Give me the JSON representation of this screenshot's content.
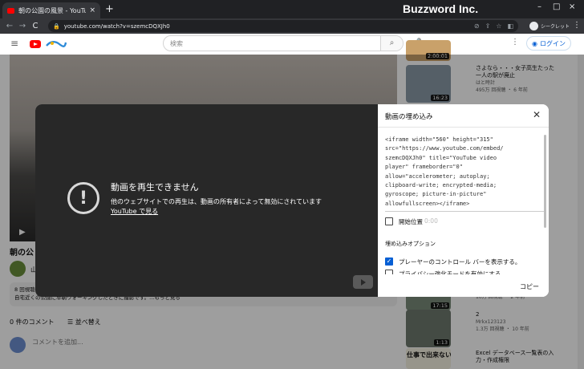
{
  "browser": {
    "tab_title": "朝の公園の風景 - YouTube",
    "close": "×",
    "newtab": "+",
    "back": "←",
    "forward": "→",
    "reload": "C",
    "url": "youtube.com/watch?v=szemcDQXJh0",
    "incognito": "シークレット",
    "brand": "Buzzword Inc.",
    "minimize": "–",
    "maximize": "□",
    "close_win": "×",
    "kebab": "⋮",
    "accent": "#202124"
  },
  "youtube": {
    "search_placeholder": "検索",
    "login": "ログイン",
    "more": "⋮",
    "menu": "≡",
    "mic": "🎤",
    "search_icon": "⌕"
  },
  "video": {
    "title": "朝の公",
    "channel_initial": "山",
    "desc_line1": "8 回視聴",
    "desc_line2": "自宅近くの公園に早朝ウォーキングしたときに撮影です。...もっと見る",
    "play": "▶"
  },
  "comments": {
    "count": "0 件のコメント",
    "sort": "並べ替え",
    "placeholder": "コメントを追加..."
  },
  "related": [
    {
      "duration": "2:00:01",
      "title": "",
      "meta": ""
    },
    {
      "duration": "16:23",
      "title": "さよなら・・・女子高生たった一人の駅が廃止",
      "meta": "はと時計\n495万 回視聴 ・ 6 年前"
    },
    {
      "duration": "17:15",
      "title": "",
      "meta": "10万 回視聴 ・ 2 年前"
    },
    {
      "duration": "1:13",
      "title": "2",
      "meta": "Mrkx123123\n1.3万 回視聴 ・ 10 年前"
    },
    {
      "duration": "",
      "title": "Excel データベース一覧表の入力・作成権限",
      "meta": ""
    }
  ],
  "thumb_caption": "仕事で出来ないと困る",
  "embed": {
    "error_title": "動画を再生できません",
    "error_line1": "他のウェブサイトでの再生は、動画の所有者によって無効にされています",
    "error_link": "YouTube で見る",
    "error_icon": "!",
    "panel_title": "動画の埋め込み",
    "panel_close": "✕",
    "code": "<iframe width=\"560\" height=\"315\"\nsrc=\"https://www.youtube.com/embed/\nszemcDQXJh0\" title=\"YouTube video\nplayer\" frameborder=\"0\"\nallow=\"accelerometer; autoplay;\nclipboard-write; encrypted-media;\ngyroscope; picture-in-picture\"\nallowfullscreen></iframe>",
    "start_label": "開始位置",
    "start_time": "0:00",
    "options_title": "埋め込みオプション",
    "option1": "プレーヤーのコントロール バーを表示する。",
    "option2": "プライバシー強化モードを有効にする。",
    "option1_checked": true,
    "copy": "コピー"
  }
}
